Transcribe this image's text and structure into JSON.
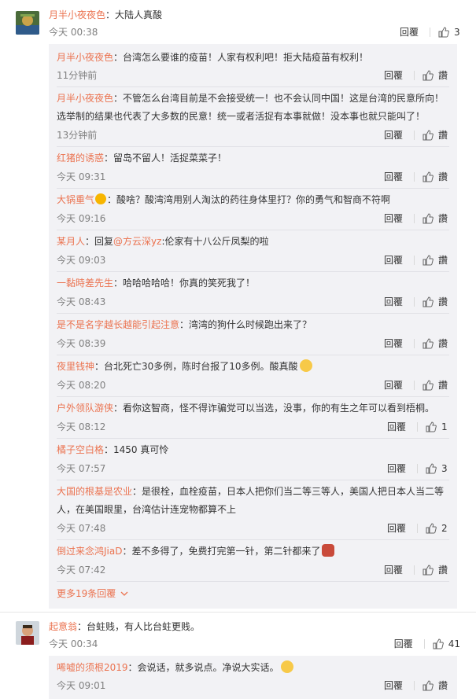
{
  "comments": [
    {
      "user": "月半小夜夜色",
      "text": "：大陆人真酸",
      "time": "今天 00:38",
      "reply_label": "回覆",
      "likes": "3",
      "replies": [
        {
          "user": "月半小夜夜色",
          "text": "：台湾怎么要谁的疫苗！人家有权利吧！拒大陆疫苗有权利！",
          "time": "11分钟前",
          "reply_label": "回覆",
          "likes": "讚"
        },
        {
          "user": "月半小夜夜色",
          "text": "：不管怎么台湾目前是不会接受统一！也不会认同中国！这是台湾的民意所向！选举制的结果也代表了大多数的民意！统一或者活捉有本事就做！没本事也就只能叫了！",
          "time": "13分钟前",
          "reply_label": "回覆",
          "likes": "讚"
        },
        {
          "user": "红猪的诱惑",
          "text": "：留岛不留人！活捉菜菜子！",
          "time": "今天 09:31",
          "reply_label": "回覆",
          "likes": "讚"
        },
        {
          "user": "大锅重气",
          "text": "：酸啥？酸湾湾用别人淘汰的药往身体里打？你的勇气和智商不符啊",
          "time": "今天 09:16",
          "reply_label": "回覆",
          "likes": "讚"
        },
        {
          "user": "某月人",
          "text_prefix": "：回复",
          "mention": "@方云深yz",
          "text": ":伦家有十八公斤凤梨的啦",
          "time": "今天 09:03",
          "reply_label": "回覆",
          "likes": "讚"
        },
        {
          "user": "一黏時差先生",
          "text": "：哈哈哈哈哈！你真的笑死我了！",
          "time": "今天 08:43",
          "reply_label": "回覆",
          "likes": "讚"
        },
        {
          "user": "是不是名字越长越能引起注意",
          "text": "：湾湾的狗什么时候跑出来了？",
          "time": "今天 08:39",
          "reply_label": "回覆",
          "likes": "讚"
        },
        {
          "user": "夜里钱神",
          "text": "：台北死亡30多例，陈时台报了10多例。酸真酸",
          "time": "今天 08:20",
          "reply_label": "回覆",
          "likes": "讚"
        },
        {
          "user": "户外领队游侠",
          "text": "：看你这智商，怪不得诈骗党可以当选，没事，你的有生之年可以看到梧桐。",
          "time": "今天 08:12",
          "reply_label": "回覆",
          "likes": "1"
        },
        {
          "user": "橘子空白格",
          "text": "：1450 真可怜",
          "time": "今天 07:57",
          "reply_label": "回覆",
          "likes": "3"
        },
        {
          "user": "大国的根基是农业",
          "text": "：是很栓，血栓疫苗，日本人把你们当二等三等人，美国人把日本人当二等人，在美国眼里，台湾估计连宠物都算不上",
          "time": "今天 07:48",
          "reply_label": "回覆",
          "likes": "2"
        },
        {
          "user": "倒过来念鸿JiaD",
          "text": "：差不多得了，免费打完第一针，第二针都来了",
          "time": "今天 07:42",
          "reply_label": "回覆",
          "likes": "讚"
        }
      ],
      "more_label": "更多19条回覆"
    },
    {
      "user": "起意翁",
      "text": "：台蛀贱，有人比台蛀更贱。",
      "time": "今天 00:34",
      "reply_label": "回覆",
      "likes": "41",
      "replies": [
        {
          "user": "唏嘘的须根2019",
          "text": "：会说话，就多说点。净说大实话。",
          "time": "今天 09:01",
          "reply_label": "回覆",
          "likes": "讚"
        }
      ]
    }
  ],
  "colors": {
    "username": "#eb7350",
    "panel": "#f2f2f5",
    "time": "#808080"
  }
}
